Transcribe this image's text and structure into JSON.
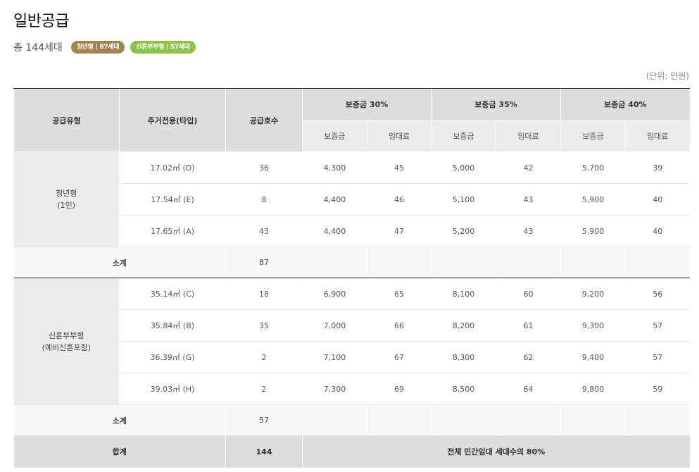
{
  "page": {
    "title": "일반공급",
    "total_label": "총 144세대",
    "badges": [
      {
        "label": "청년형 | 87세대",
        "color": "#a5834f"
      },
      {
        "label": "신혼부부형 | 57세대",
        "color": "#8bc34a"
      }
    ],
    "unit_note": "(단위: 만원)"
  },
  "table": {
    "headers": {
      "supply_type": "공급유형",
      "exclusive_area": "주거전용(타입)",
      "supply_units": "공급호수",
      "groups": [
        "보증금 30%",
        "보증금 35%",
        "보증금 40%"
      ],
      "sub_deposit": "보증금",
      "sub_rent": "임대료"
    },
    "sections": [
      {
        "name_line1": "청년형",
        "name_line2": "(1인)",
        "rows": [
          {
            "area": "17.02㎡ (D)",
            "units": "36",
            "d30": "4,300",
            "r30": "45",
            "d35": "5,000",
            "r35": "42",
            "d40": "5,700",
            "r40": "39"
          },
          {
            "area": "17.54㎡ (E)",
            "units": "8",
            "d30": "4,400",
            "r30": "46",
            "d35": "5,100",
            "r35": "43",
            "d40": "5,900",
            "r40": "40"
          },
          {
            "area": "17.65㎡ (A)",
            "units": "43",
            "d30": "4,400",
            "r30": "47",
            "d35": "5,200",
            "r35": "43",
            "d40": "5,900",
            "r40": "40"
          }
        ],
        "subtotal_label": "소계",
        "subtotal_units": "87"
      },
      {
        "name_line1": "신혼부부형",
        "name_line2": "(예비신혼포함)",
        "rows": [
          {
            "area": "35.14㎡ (C)",
            "units": "18",
            "d30": "6,900",
            "r30": "65",
            "d35": "8,100",
            "r35": "60",
            "d40": "9,200",
            "r40": "56"
          },
          {
            "area": "35.84㎡ (B)",
            "units": "35",
            "d30": "7,000",
            "r30": "66",
            "d35": "8,200",
            "r35": "61",
            "d40": "9,300",
            "r40": "57"
          },
          {
            "area": "36.39㎡ (G)",
            "units": "2",
            "d30": "7,100",
            "r30": "67",
            "d35": "8,300",
            "r35": "62",
            "d40": "9,400",
            "r40": "57"
          },
          {
            "area": "39.03㎡ (H)",
            "units": "2",
            "d30": "7,300",
            "r30": "69",
            "d35": "8,500",
            "r35": "64",
            "d40": "9,800",
            "r40": "59"
          }
        ],
        "subtotal_label": "소계",
        "subtotal_units": "57"
      }
    ],
    "total": {
      "label": "합계",
      "units": "144",
      "note": "전체 민간임대 세대수의 80%"
    }
  }
}
